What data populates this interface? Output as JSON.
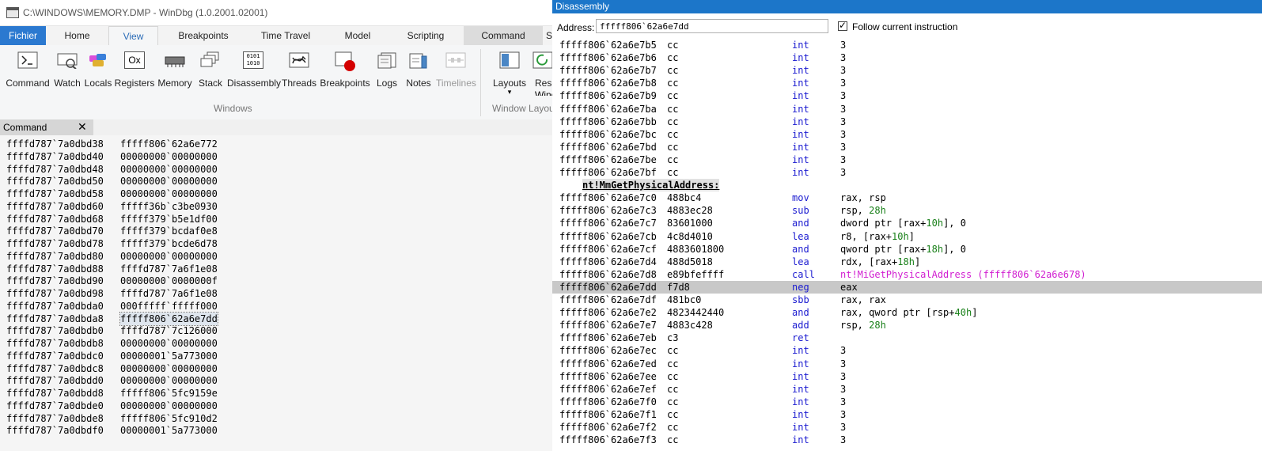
{
  "window": {
    "title": "C:\\WINDOWS\\MEMORY.DMP - WinDbg (1.0.2001.02001)"
  },
  "ribbon_tabs": [
    {
      "label": "Fichier"
    },
    {
      "label": "Home"
    },
    {
      "label": "View"
    },
    {
      "label": "Breakpoints"
    },
    {
      "label": "Time Travel"
    },
    {
      "label": "Model"
    },
    {
      "label": "Scripting"
    },
    {
      "label": "Command"
    },
    {
      "label": "S"
    }
  ],
  "ribbon_buttons": [
    {
      "label": "Command",
      "icon": "command-prompt-icon"
    },
    {
      "label": "Watch",
      "icon": "watch-icon"
    },
    {
      "label": "Locals",
      "icon": "locals-icon"
    },
    {
      "label": "Registers",
      "icon": "registers-icon"
    },
    {
      "label": "Memory",
      "icon": "memory-icon"
    },
    {
      "label": "Stack",
      "icon": "stack-icon"
    },
    {
      "label": "Disassembly",
      "icon": "disassembly-icon"
    },
    {
      "label": "Threads",
      "icon": "threads-icon"
    },
    {
      "label": "Breakpoints",
      "icon": "breakpoint-icon"
    },
    {
      "label": "Logs",
      "icon": "logs-icon"
    },
    {
      "label": "Notes",
      "icon": "notes-icon"
    },
    {
      "label": "Timelines",
      "icon": "timelines-icon",
      "disabled": true
    },
    {
      "label": "Layouts",
      "icon": "layouts-icon"
    },
    {
      "label": "Reset",
      "icon": "reset-icon"
    }
  ],
  "ribbon_extra": {
    "layouts_arrow": "▾",
    "reset_line2": "Windo",
    "registers_icon_text": "Ox",
    "disassembly_icon_text": "0101\n1010"
  },
  "ribbon_groups": {
    "windows": "Windows",
    "layout": "Window Layou"
  },
  "command_panel": {
    "tab_label": "Command",
    "close_glyph": "✕",
    "rows": [
      {
        "addr": "ffffd787`7a0dbd38",
        "value": "fffff806`62a6e772"
      },
      {
        "addr": "ffffd787`7a0dbd40",
        "value": "00000000`00000000"
      },
      {
        "addr": "ffffd787`7a0dbd48",
        "value": "00000000`00000000"
      },
      {
        "addr": "ffffd787`7a0dbd50",
        "value": "00000000`00000000"
      },
      {
        "addr": "ffffd787`7a0dbd58",
        "value": "00000000`00000000"
      },
      {
        "addr": "ffffd787`7a0dbd60",
        "value": "fffff36b`c3be0930"
      },
      {
        "addr": "ffffd787`7a0dbd68",
        "value": "fffff379`b5e1df00"
      },
      {
        "addr": "ffffd787`7a0dbd70",
        "value": "fffff379`bcdaf0e8"
      },
      {
        "addr": "ffffd787`7a0dbd78",
        "value": "fffff379`bcde6d78"
      },
      {
        "addr": "ffffd787`7a0dbd80",
        "value": "00000000`00000000"
      },
      {
        "addr": "ffffd787`7a0dbd88",
        "value": "ffffd787`7a6f1e08"
      },
      {
        "addr": "ffffd787`7a0dbd90",
        "value": "00000000`0000000f"
      },
      {
        "addr": "ffffd787`7a0dbd98",
        "value": "ffffd787`7a6f1e08"
      },
      {
        "addr": "ffffd787`7a0dbda0",
        "value": "000fffff`fffff000"
      },
      {
        "addr": "ffffd787`7a0dbda8",
        "value": "fffff806`62a6e7dd",
        "selected": true
      },
      {
        "addr": "ffffd787`7a0dbdb0",
        "value": "ffffd787`7c126000"
      },
      {
        "addr": "ffffd787`7a0dbdb8",
        "value": "00000000`00000000"
      },
      {
        "addr": "ffffd787`7a0dbdc0",
        "value": "00000001`5a773000"
      },
      {
        "addr": "ffffd787`7a0dbdc8",
        "value": "00000000`00000000"
      },
      {
        "addr": "ffffd787`7a0dbdd0",
        "value": "00000000`00000000"
      },
      {
        "addr": "ffffd787`7a0dbdd8",
        "value": "fffff806`5fc9159e"
      },
      {
        "addr": "ffffd787`7a0dbde0",
        "value": "00000000`00000000"
      },
      {
        "addr": "ffffd787`7a0dbde8",
        "value": "fffff806`5fc910d2"
      },
      {
        "addr": "ffffd787`7a0dbdf0",
        "value": "00000001`5a773000"
      }
    ]
  },
  "disassembly": {
    "title": "Disassembly",
    "address_label": "Address:",
    "address_value": "fffff806`62a6e7dd",
    "follow_label": "Follow current instruction",
    "follow_checked": true,
    "rows": [
      {
        "addr": "fffff806`62a6e7b5",
        "bytes": "cc",
        "mn": "int",
        "ops": [
          {
            "t": "3",
            "k": "plain"
          }
        ]
      },
      {
        "addr": "fffff806`62a6e7b6",
        "bytes": "cc",
        "mn": "int",
        "ops": [
          {
            "t": "3",
            "k": "plain"
          }
        ]
      },
      {
        "addr": "fffff806`62a6e7b7",
        "bytes": "cc",
        "mn": "int",
        "ops": [
          {
            "t": "3",
            "k": "plain"
          }
        ]
      },
      {
        "addr": "fffff806`62a6e7b8",
        "bytes": "cc",
        "mn": "int",
        "ops": [
          {
            "t": "3",
            "k": "plain"
          }
        ]
      },
      {
        "addr": "fffff806`62a6e7b9",
        "bytes": "cc",
        "mn": "int",
        "ops": [
          {
            "t": "3",
            "k": "plain"
          }
        ]
      },
      {
        "addr": "fffff806`62a6e7ba",
        "bytes": "cc",
        "mn": "int",
        "ops": [
          {
            "t": "3",
            "k": "plain"
          }
        ]
      },
      {
        "addr": "fffff806`62a6e7bb",
        "bytes": "cc",
        "mn": "int",
        "ops": [
          {
            "t": "3",
            "k": "plain"
          }
        ]
      },
      {
        "addr": "fffff806`62a6e7bc",
        "bytes": "cc",
        "mn": "int",
        "ops": [
          {
            "t": "3",
            "k": "plain"
          }
        ]
      },
      {
        "addr": "fffff806`62a6e7bd",
        "bytes": "cc",
        "mn": "int",
        "ops": [
          {
            "t": "3",
            "k": "plain"
          }
        ]
      },
      {
        "addr": "fffff806`62a6e7be",
        "bytes": "cc",
        "mn": "int",
        "ops": [
          {
            "t": "3",
            "k": "plain"
          }
        ]
      },
      {
        "addr": "fffff806`62a6e7bf",
        "bytes": "cc",
        "mn": "int",
        "ops": [
          {
            "t": "3",
            "k": "plain"
          }
        ]
      },
      {
        "label": "nt!MmGetPhysicalAddress:"
      },
      {
        "addr": "fffff806`62a6e7c0",
        "bytes": "488bc4",
        "mn": "mov",
        "ops": [
          {
            "t": "rax, rsp",
            "k": "plain"
          }
        ]
      },
      {
        "addr": "fffff806`62a6e7c3",
        "bytes": "4883ec28",
        "mn": "sub",
        "ops": [
          {
            "t": "rsp, ",
            "k": "plain"
          },
          {
            "t": "28h",
            "k": "num"
          }
        ]
      },
      {
        "addr": "fffff806`62a6e7c7",
        "bytes": "83601000",
        "mn": "and",
        "ops": [
          {
            "t": "dword ptr [rax+",
            "k": "plain"
          },
          {
            "t": "10h",
            "k": "num"
          },
          {
            "t": "], 0",
            "k": "plain"
          }
        ]
      },
      {
        "addr": "fffff806`62a6e7cb",
        "bytes": "4c8d4010",
        "mn": "lea",
        "ops": [
          {
            "t": "r8, [rax+",
            "k": "plain"
          },
          {
            "t": "10h",
            "k": "num"
          },
          {
            "t": "]",
            "k": "plain"
          }
        ]
      },
      {
        "addr": "fffff806`62a6e7cf",
        "bytes": "4883601800",
        "mn": "and",
        "ops": [
          {
            "t": "qword ptr [rax+",
            "k": "plain"
          },
          {
            "t": "18h",
            "k": "num"
          },
          {
            "t": "], 0",
            "k": "plain"
          }
        ]
      },
      {
        "addr": "fffff806`62a6e7d4",
        "bytes": "488d5018",
        "mn": "lea",
        "ops": [
          {
            "t": "rdx, [rax+",
            "k": "plain"
          },
          {
            "t": "18h",
            "k": "num"
          },
          {
            "t": "]",
            "k": "plain"
          }
        ]
      },
      {
        "addr": "fffff806`62a6e7d8",
        "bytes": "e89bfeffff",
        "mn": "call",
        "ops": [
          {
            "t": "nt!MiGetPhysicalAddress (fffff806`62a6e678)",
            "k": "sym"
          }
        ]
      },
      {
        "addr": "fffff806`62a6e7dd",
        "bytes": "f7d8",
        "mn": "neg",
        "ops": [
          {
            "t": "eax",
            "k": "plain"
          }
        ],
        "current": true
      },
      {
        "addr": "fffff806`62a6e7df",
        "bytes": "481bc0",
        "mn": "sbb",
        "ops": [
          {
            "t": "rax, rax",
            "k": "plain"
          }
        ]
      },
      {
        "addr": "fffff806`62a6e7e2",
        "bytes": "4823442440",
        "mn": "and",
        "ops": [
          {
            "t": "rax, qword ptr [rsp+",
            "k": "plain"
          },
          {
            "t": "40h",
            "k": "num"
          },
          {
            "t": "]",
            "k": "plain"
          }
        ]
      },
      {
        "addr": "fffff806`62a6e7e7",
        "bytes": "4883c428",
        "mn": "add",
        "ops": [
          {
            "t": "rsp, ",
            "k": "plain"
          },
          {
            "t": "28h",
            "k": "num"
          }
        ]
      },
      {
        "addr": "fffff806`62a6e7eb",
        "bytes": "c3",
        "mn": "ret",
        "ops": []
      },
      {
        "addr": "fffff806`62a6e7ec",
        "bytes": "cc",
        "mn": "int",
        "ops": [
          {
            "t": "3",
            "k": "plain"
          }
        ]
      },
      {
        "addr": "fffff806`62a6e7ed",
        "bytes": "cc",
        "mn": "int",
        "ops": [
          {
            "t": "3",
            "k": "plain"
          }
        ]
      },
      {
        "addr": "fffff806`62a6e7ee",
        "bytes": "cc",
        "mn": "int",
        "ops": [
          {
            "t": "3",
            "k": "plain"
          }
        ]
      },
      {
        "addr": "fffff806`62a6e7ef",
        "bytes": "cc",
        "mn": "int",
        "ops": [
          {
            "t": "3",
            "k": "plain"
          }
        ]
      },
      {
        "addr": "fffff806`62a6e7f0",
        "bytes": "cc",
        "mn": "int",
        "ops": [
          {
            "t": "3",
            "k": "plain"
          }
        ]
      },
      {
        "addr": "fffff806`62a6e7f1",
        "bytes": "cc",
        "mn": "int",
        "ops": [
          {
            "t": "3",
            "k": "plain"
          }
        ]
      },
      {
        "addr": "fffff806`62a6e7f2",
        "bytes": "cc",
        "mn": "int",
        "ops": [
          {
            "t": "3",
            "k": "plain"
          }
        ]
      },
      {
        "addr": "fffff806`62a6e7f3",
        "bytes": "cc",
        "mn": "int",
        "ops": [
          {
            "t": "3",
            "k": "plain"
          }
        ]
      }
    ]
  },
  "colors": {
    "accent_blue": "#1c76c9",
    "mnemonic": "#1a1ad0",
    "number": "#198019",
    "symbol": "#d11ed1",
    "current_line": "#c8c8c8"
  }
}
